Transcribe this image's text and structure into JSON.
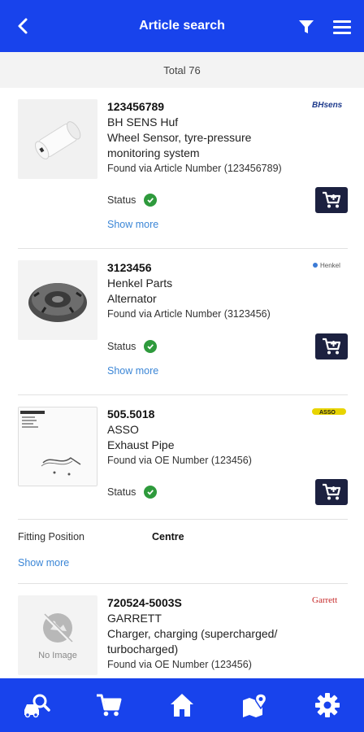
{
  "header": {
    "title": "Article search",
    "back_icon": "arrow-left-icon",
    "filter_icon": "filter-icon",
    "menu_icon": "hamburger-menu-icon",
    "bg_color": "#1843ec"
  },
  "summary": {
    "total_label": "Total 76"
  },
  "articles": [
    {
      "article_number": "123456789",
      "brand": "BH SENS Huf",
      "description": "Wheel Sensor, tyre-pressure monitoring system",
      "found_via": "Found via Article Number (123456789)",
      "status_label": "Status",
      "status": "available",
      "show_more": "Show more",
      "brand_logo_text": "BHsens"
    },
    {
      "article_number": "3123456",
      "brand": "Henkel Parts",
      "description": "Alternator",
      "found_via": "Found via Article Number (3123456)",
      "status_label": "Status",
      "status": "available",
      "show_more": "Show more",
      "brand_logo_text": "Henkel"
    },
    {
      "article_number": "505.5018",
      "brand": "ASSO",
      "description": "Exhaust Pipe",
      "found_via": "Found via OE Number (123456)",
      "status_label": "Status",
      "status": "available",
      "brand_logo_text": "ASSO",
      "fitting_position_label": "Fitting Position",
      "fitting_position_value": "Centre",
      "show_more": "Show more"
    },
    {
      "article_number": "720524-5003S",
      "brand": "GARRETT",
      "description": "Charger, charging (supercharged/ turbocharged)",
      "found_via": "Found via OE Number (123456)",
      "no_image_label": "No Image",
      "brand_logo_text": "Garrett"
    }
  ],
  "bottom_nav": [
    {
      "icon": "vehicle-search-icon"
    },
    {
      "icon": "cart-icon"
    },
    {
      "icon": "home-icon"
    },
    {
      "icon": "map-location-icon"
    },
    {
      "icon": "settings-gear-icon"
    }
  ]
}
